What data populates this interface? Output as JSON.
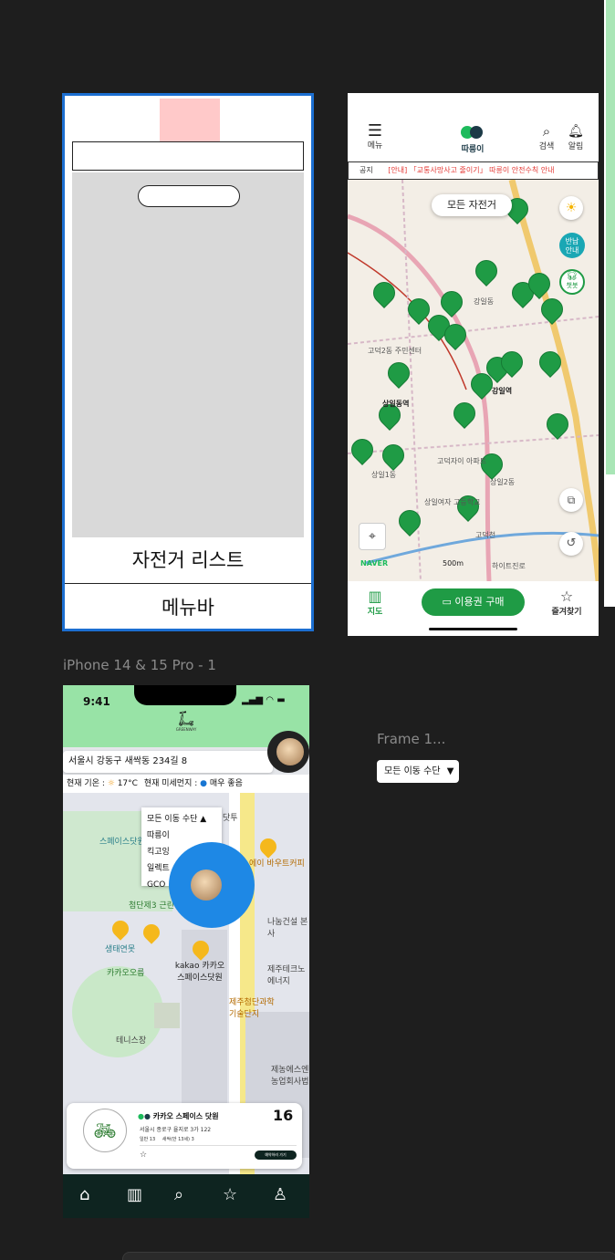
{
  "wireframe": {
    "list_label": "자전거 리스트",
    "menubar_label": "메뉴바"
  },
  "ddareungi": {
    "header": {
      "menu_label": "메뉴",
      "brand": "따릉이",
      "search_label": "검색",
      "alert_label": "알림"
    },
    "notice": {
      "prefix": "공지",
      "text": "[안내] 「교통사망사고 줄이기」 따릉이 안전수칙 안내"
    },
    "filter_chip": "모든 자전거",
    "side_buttons": {
      "guide": "반납\n안내",
      "chatbot": "챗봇"
    },
    "map_labels": [
      "강일동",
      "상일동역",
      "강일역",
      "상일1동",
      "상일2동",
      "고덕2동 주민센터",
      "고덕자이 아파트",
      "상일여자 고등학교",
      "고덕천",
      "하이트진로",
      "500m",
      "NAVER"
    ],
    "bottom_nav": {
      "map": "지도",
      "pass_button": "이용권 구매",
      "favorites": "즐겨찾기"
    }
  },
  "figma_labels": {
    "iphone_frame": "iPhone 14 & 15 Pro - 1",
    "frame1": "Frame 1...",
    "dropdown": "모든 이동 수단"
  },
  "greenway": {
    "status_time": "9:41",
    "logo_text": "GREENWAY",
    "address": "서울시 강동구 새싹동 234길 8",
    "weather": {
      "temp_label": "현재 기온 :",
      "temp": "17°C",
      "dust_label": "현재 미세먼지 :",
      "dust": "매우 좋음"
    },
    "dropdown": {
      "title": "모든 이동 수단",
      "options": [
        "따릉이",
        "킥고잉",
        "일렉트",
        "GCO"
      ]
    },
    "map_labels": [
      "스페이스닷원 어린이집",
      "첨단제3 근린공원",
      "생태연못",
      "카카오오름",
      "kakao 카카오 스페이스닷원",
      "에이 바우트커피",
      "나눔건설 본사",
      "제주테크노 에너지",
      "제주첨단과학 기술단지",
      "테니스장",
      "제농에스엔 농업회사법",
      "닷투"
    ],
    "station_card": {
      "name": "카카오 스페이스 닷원",
      "address": "서울시 종로구 율지로 3가 122",
      "detail1": "일반 13",
      "detail2": "새싹(만 13세) 3",
      "count": "16",
      "action": "예약하러 가기"
    }
  }
}
